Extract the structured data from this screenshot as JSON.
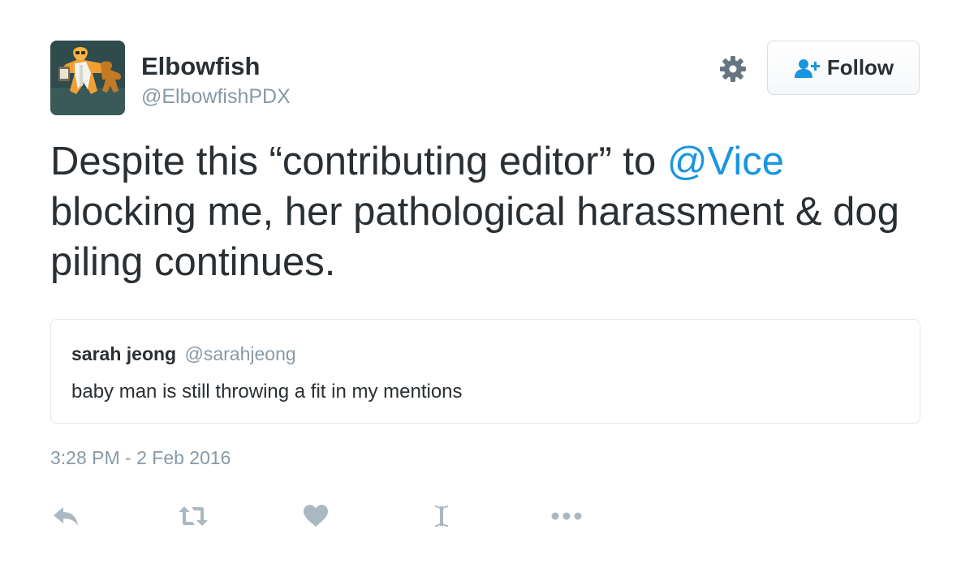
{
  "user": {
    "display_name": "Elbowfish",
    "screen_name": "@ElbowfishPDX",
    "avatar_icon": "meeple-scientist-avatar"
  },
  "header": {
    "settings_icon": "gear-icon",
    "follow_label": "Follow",
    "follow_icon": "follow-person-plus-icon"
  },
  "tweet": {
    "text_parts": {
      "line1_prefix": "Despite this “contributing editor” to ",
      "mention": "@Vice",
      "line2": "blocking me, her pathological harassment & dog",
      "line3": "piling continues."
    },
    "timestamp": "3:28 PM - 2 Feb 2016"
  },
  "quoted_tweet": {
    "name": "sarah jeong",
    "handle": "@sarahjeong",
    "text": "baby man is still throwing a fit in my mentions"
  },
  "actions": [
    {
      "name": "reply",
      "icon": "reply-icon"
    },
    {
      "name": "retweet",
      "icon": "retweet-icon"
    },
    {
      "name": "like",
      "icon": "heart-icon"
    },
    {
      "name": "moments",
      "icon": "moment-i-icon"
    },
    {
      "name": "more",
      "icon": "ellipsis-icon"
    }
  ],
  "colors": {
    "text": "#292f33",
    "secondary_text": "#8899a6",
    "link": "#1b95e0",
    "border": "#e1e8ed",
    "icon": "#aab8c2"
  }
}
